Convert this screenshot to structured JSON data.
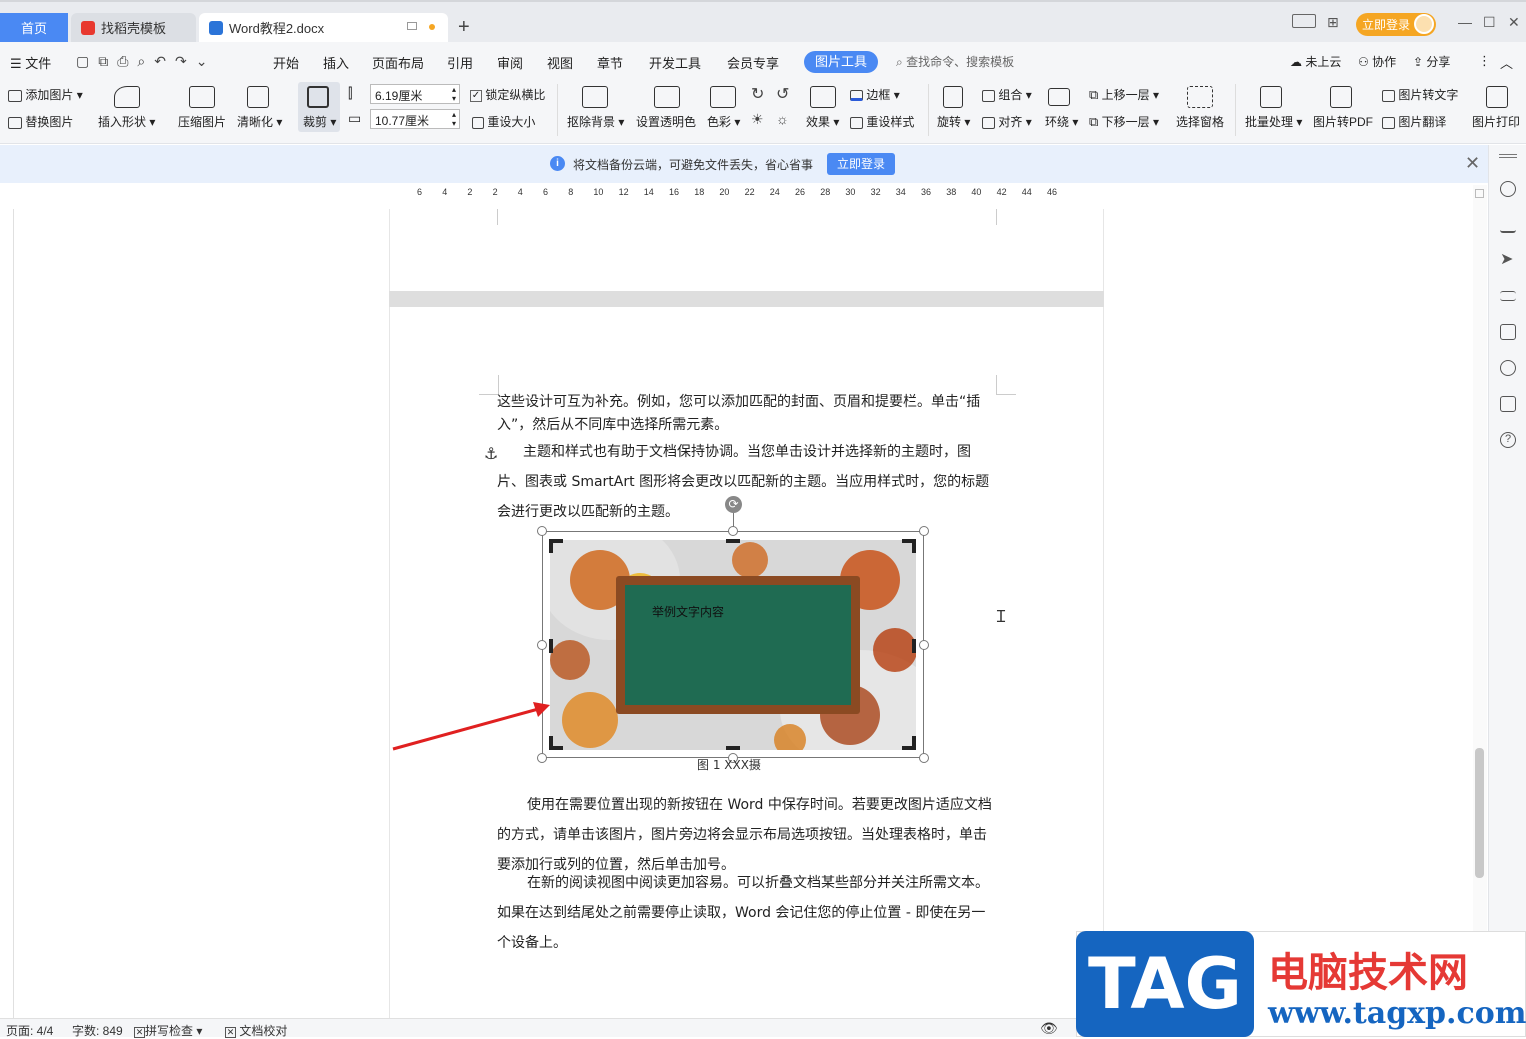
{
  "tabs": {
    "home": "首页",
    "template": "找稻壳模板",
    "doc": "Word教程2.docx"
  },
  "header": {
    "login": "立即登录"
  },
  "menu": {
    "file": "文件",
    "items": [
      "开始",
      "插入",
      "页面布局",
      "引用",
      "审阅",
      "视图",
      "章节",
      "开发工具",
      "会员专享"
    ],
    "picture_tools": "图片工具",
    "search_placeholder": "查找命令、搜索模板",
    "cloud": "未上云",
    "collab": "协作",
    "share": "分享"
  },
  "ribbon": {
    "add_picture": "添加图片",
    "replace_picture": "替换图片",
    "insert_shape": "插入形状",
    "compress": "压缩图片",
    "sharpen": "清晰化",
    "crop": "裁剪",
    "height": "6.19厘米",
    "width": "10.77厘米",
    "lock_ratio": "锁定纵横比",
    "reset_size": "重设大小",
    "remove_bg": "抠除背景",
    "set_transparent": "设置透明色",
    "color": "色彩",
    "effect": "效果",
    "border": "边框",
    "reset_style": "重设样式",
    "rotate": "旋转",
    "group": "组合",
    "align": "对齐",
    "wrap": "环绕",
    "bring_forward": "上移一层",
    "send_backward": "下移一层",
    "selection_pane": "选择窗格",
    "batch": "批量处理",
    "to_pdf": "图片转PDF",
    "to_text": "图片转文字",
    "translate": "图片翻译",
    "print": "图片打印"
  },
  "notice": {
    "text": "将文档备份云端，可避免文件丢失，省心省事",
    "button": "立即登录"
  },
  "ruler": {
    "h": [
      "6",
      "4",
      "2",
      "2",
      "4",
      "6",
      "8",
      "10",
      "12",
      "14",
      "16",
      "18",
      "20",
      "22",
      "24",
      "26",
      "28",
      "30",
      "32",
      "34",
      "36",
      "38",
      "40",
      "42",
      "44",
      "46"
    ]
  },
  "document": {
    "p1": "这些设计可互为补充。例如，您可以添加匹配的封面、页眉和提要栏。单击“插入”，然后从不同库中选择所需元素。",
    "p2": "主题和样式也有助于文档保持协调。当您单击设计并选择新的主题时，图片、图表或 SmartArt 图形将会更改以匹配新的主题。当应用样式时，您的标题会进行更改以匹配新的主题。",
    "image_text": "举例文字内容",
    "caption": "图 1 XXX摄",
    "p3": "使用在需要位置出现的新按钮在 Word 中保存时间。若要更改图片适应文档的方式，请单击该图片，图片旁边将会显示布局选项按钮。当处理表格时，单击要添加行或列的位置，然后单击加号。",
    "p4": "在新的阅读视图中阅读更加容易。可以折叠文档某些部分并关注所需文本。如果在达到结尾处之前需要停止读取，Word 会记住您的停止位置 - 即使在另一个设备上。"
  },
  "status": {
    "page": "页面: 4/4",
    "words": "字数: 849",
    "spell": "拼写检查",
    "proof": "文档校对"
  },
  "watermark": {
    "tag": "TAG",
    "cn": "电脑技术网",
    "url": "www.tagxp.com"
  },
  "colors": {
    "accent": "#4a89f3",
    "login": "#f5a623",
    "board": "#1f6b52",
    "frame": "#8b4a22"
  }
}
